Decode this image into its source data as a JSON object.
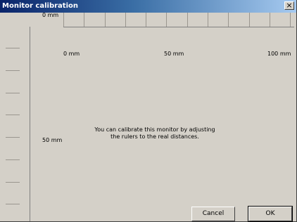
{
  "window": {
    "title": "Monitor calibration",
    "close_label": "×"
  },
  "vertical_ruler": {
    "labels": {
      "top": "0 mm",
      "mid": "50 mm"
    }
  },
  "horizontal_ruler": {
    "labels": {
      "start": "0 mm",
      "mid": "50 mm",
      "end": "100 mm"
    }
  },
  "message": {
    "line1": "You can calibrate this monitor by adjusting",
    "line2": "the rulers to the real distances."
  },
  "buttons": {
    "cancel": "Cancel",
    "ok": "OK"
  }
}
